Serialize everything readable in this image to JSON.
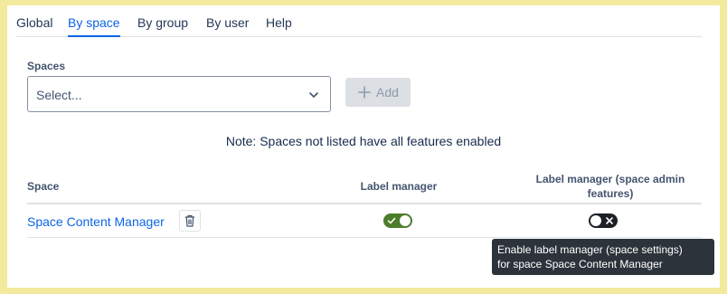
{
  "tabs": [
    {
      "label": "Global"
    },
    {
      "label": "By space",
      "active": true
    },
    {
      "label": "By group"
    },
    {
      "label": "By user"
    },
    {
      "label": "Help"
    }
  ],
  "spaces_field": {
    "label": "Spaces",
    "placeholder": "Select...",
    "add_label": "Add"
  },
  "note": "Note: Spaces not listed have all features enabled",
  "table": {
    "headers": {
      "space": "Space",
      "label_manager": "Label manager",
      "label_manager_admin_line1": "Label manager (space admin",
      "label_manager_admin_line2": "features)"
    },
    "rows": [
      {
        "space": "Space Content Manager",
        "label_manager": true,
        "label_manager_admin": false
      }
    ]
  },
  "tooltip": {
    "line1": "Enable label manager (space settings)",
    "line2": "for space Space Content Manager"
  },
  "colors": {
    "accent": "#0c66e4",
    "toggle_on": "#4c7d2c",
    "toggle_off": "#1d2125",
    "tooltip_bg": "#2c333a",
    "frame": "#f3ea9d"
  },
  "icons": {
    "select_chevron": "chevron-down-icon",
    "add": "plus-icon",
    "delete": "trash-icon",
    "toggle_on": "check-icon",
    "toggle_off": "close-icon"
  }
}
